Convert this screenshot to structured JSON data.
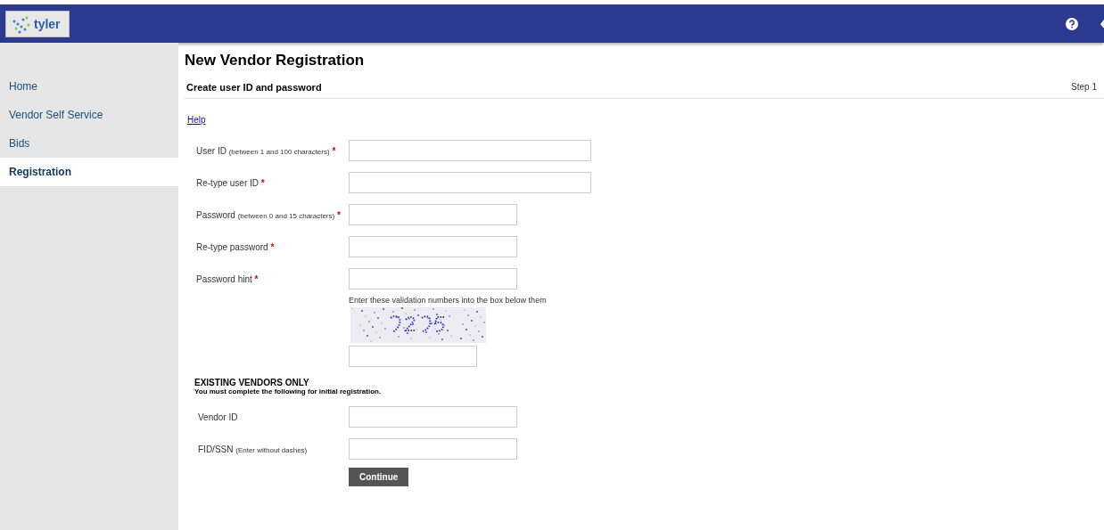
{
  "logo": {
    "text": "tyler"
  },
  "sidebar": {
    "items": [
      {
        "label": "Home",
        "selected": false
      },
      {
        "label": "Vendor Self Service",
        "selected": false
      },
      {
        "label": "Bids",
        "selected": false
      },
      {
        "label": "Registration",
        "selected": true
      }
    ]
  },
  "page": {
    "title": "New Vendor Registration",
    "section": "Create user ID and password",
    "step": "Step 1",
    "help_link": "Help"
  },
  "fields": [
    {
      "label": "User ID",
      "note": "(between 1 and 100 characters)",
      "required_mark": "*",
      "kind": "wide"
    },
    {
      "label": "Re-type user ID",
      "required_mark": "*",
      "kind": "wide"
    },
    {
      "label": "Password",
      "note": "(between 0 and 15 characters)",
      "required_mark": "*",
      "kind": "medium"
    },
    {
      "label": "Re-type password",
      "required_mark": "*",
      "kind": "medium"
    },
    {
      "label": "Password hint",
      "required_mark": "*",
      "kind": "medium"
    }
  ],
  "validation": {
    "instruction": "Enter these validation numbers into the box below them"
  },
  "existing_vendors": {
    "heading": "EXISTING VENDORS ONLY",
    "subheading": "You must complete the following for initial registration.",
    "fields": [
      {
        "label": "Vendor ID"
      },
      {
        "label": "FID/SSN",
        "note": "(Enter without dashes)"
      }
    ]
  },
  "buttons": [
    "Continue"
  ]
}
